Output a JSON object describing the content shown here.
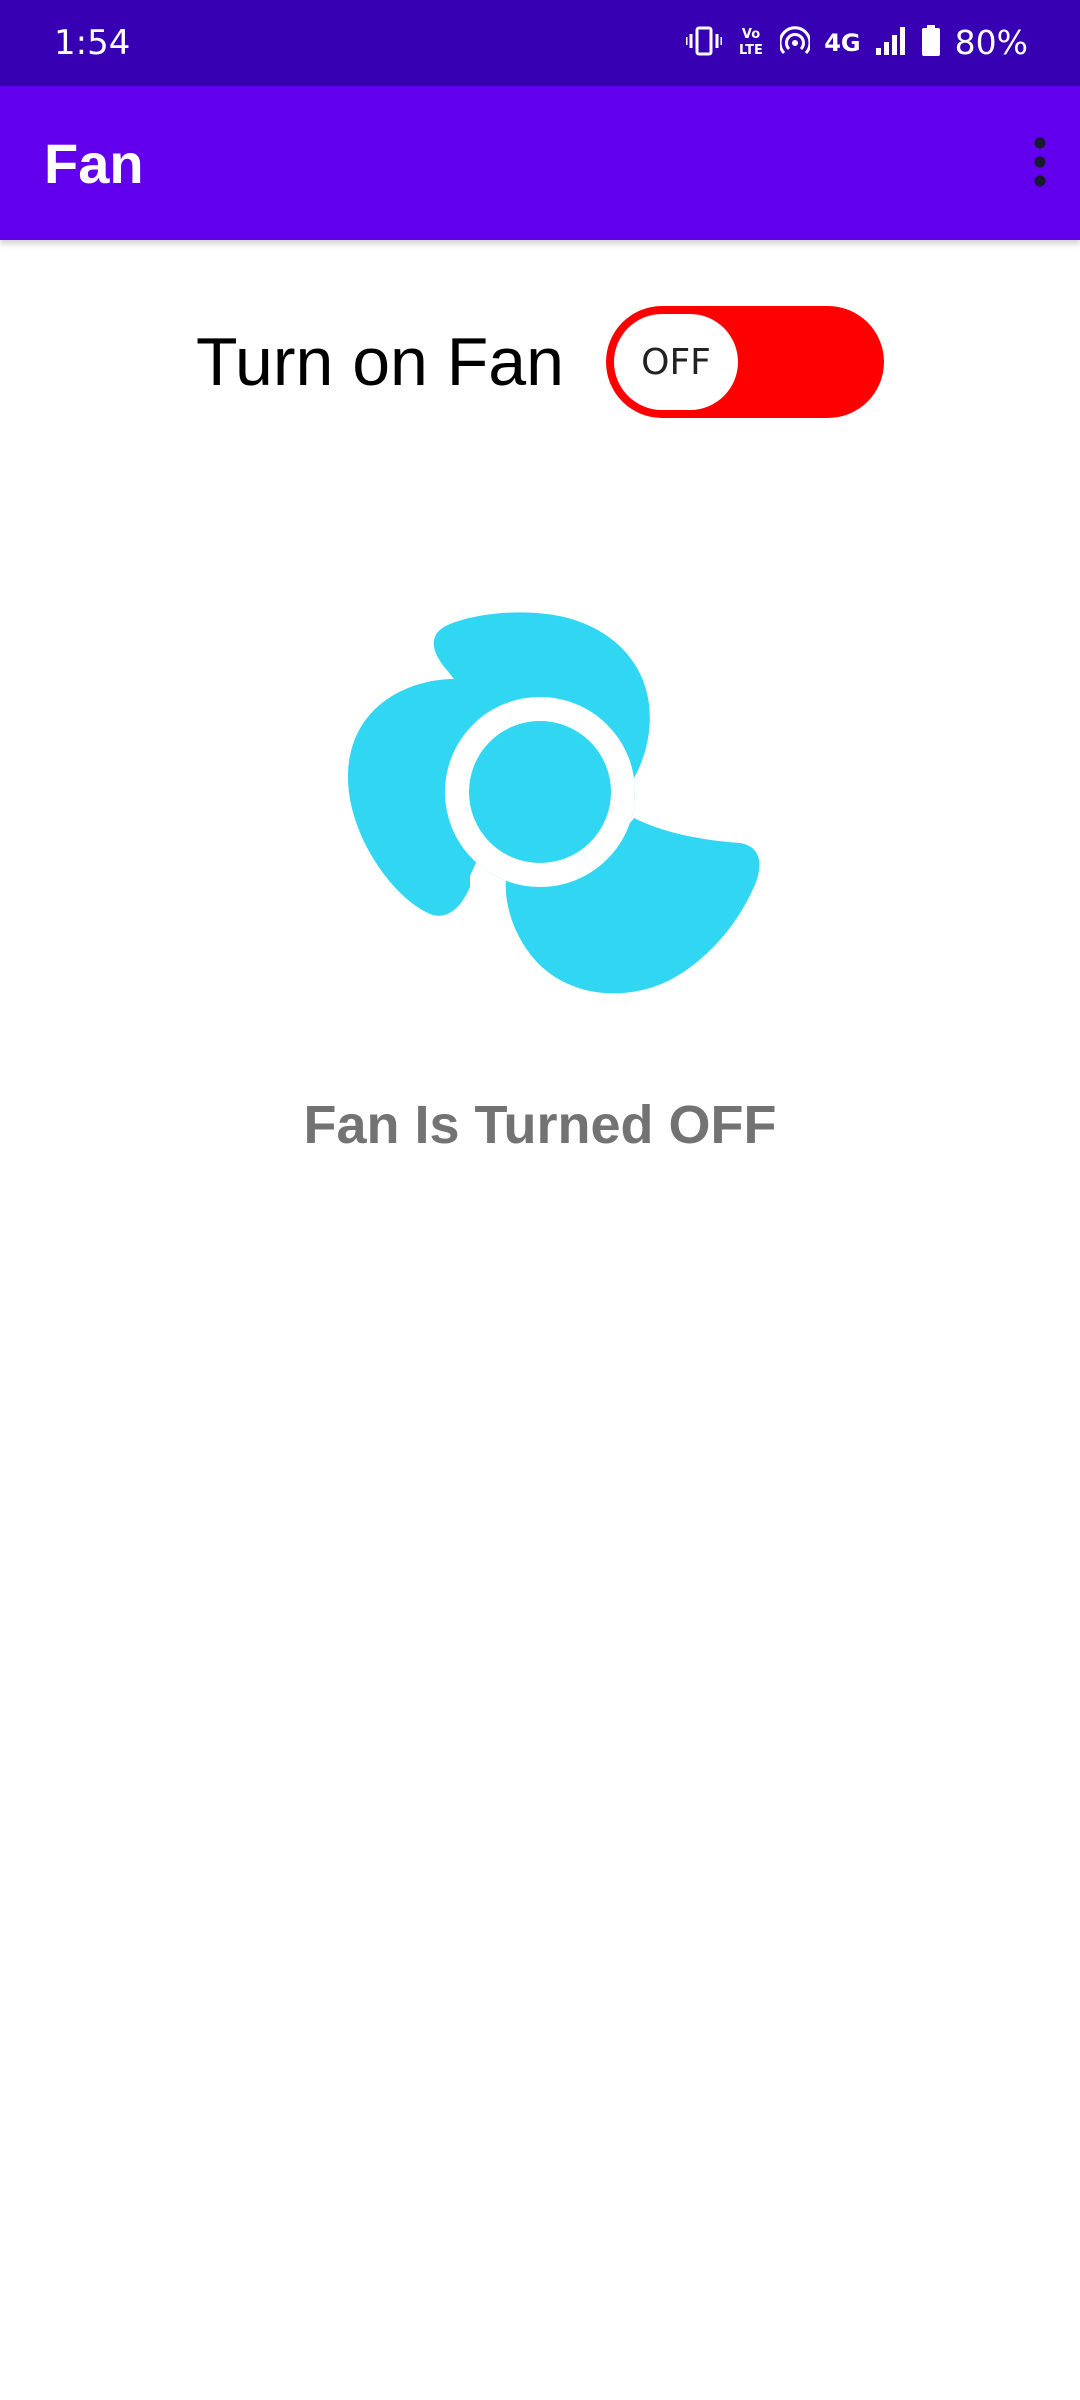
{
  "status_bar": {
    "time": "1:54",
    "battery_percent": "80%",
    "network": "4G",
    "volte": "Vo LTE",
    "icons": [
      "vibrate-icon",
      "volte-icon",
      "hotspot-icon",
      "signal-icon",
      "battery-icon"
    ]
  },
  "app_bar": {
    "title": "Fan",
    "overflow_icon": "more-vert-icon"
  },
  "fan_toggle": {
    "label": "Turn on Fan",
    "state_text": "OFF",
    "is_on": false,
    "track_color": "#ff0000"
  },
  "fan": {
    "icon": "fan-icon",
    "color": "#31d7f2"
  },
  "status_message": "Fan Is Turned OFF",
  "colors": {
    "status_bar": "#3700b3",
    "app_bar": "#6200ee",
    "message_text": "#737373"
  }
}
